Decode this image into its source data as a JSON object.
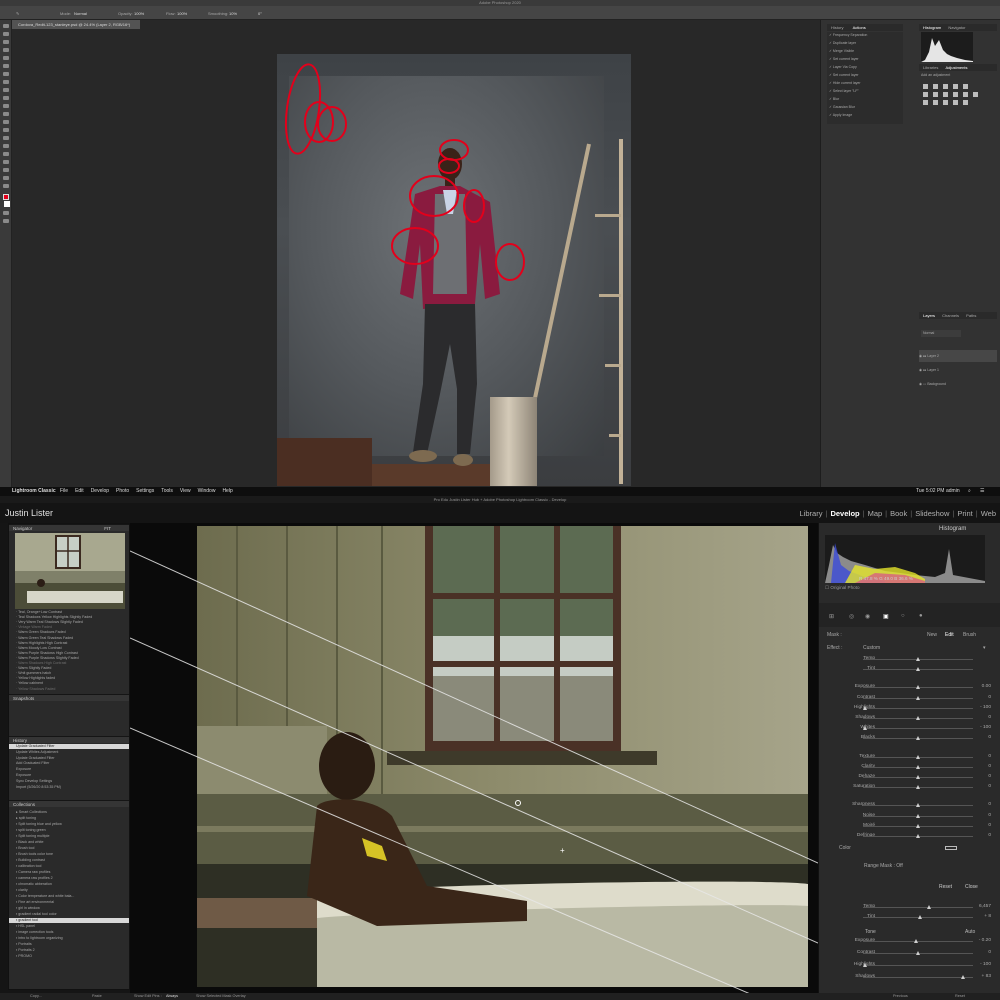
{
  "photoshop": {
    "window_title": "Adobe Photoshop 2020",
    "document_tab": "Cordova_Redit-123_stanleye.psd @ 24.4% (Layer 2, RGB/16*)",
    "options": {
      "mode_label": "Mode:",
      "mode_value": "Normal",
      "opacity_label": "Opacity:",
      "opacity_value": "100%",
      "flow_label": "Flow:",
      "flow_value": "100%",
      "smoothing_label": "Smoothing:",
      "smoothing_value": "10%",
      "angle_value": "0°"
    },
    "panels": {
      "history_tab": "History",
      "actions_tab": "Actions",
      "histogram_tab": "Histogram",
      "navigator_tab": "Navigator",
      "libraries_tab": "Libraries",
      "adjustments_tab": "Adjustments",
      "add_adjustment": "Add an adjustment",
      "layers_tab": "Layers",
      "channels_tab": "Channels",
      "paths_tab": "Paths",
      "blend_mode": "Normal",
      "actions_items": [
        "Frequency Separation",
        "Duplicate layer",
        "Merge Visible",
        "Set current layer",
        "Layer Via Copy",
        "Set current layer",
        "Hide current layer",
        "Select layer \"LF\"",
        "Blur",
        "Gaussian Blur",
        "Apply Image"
      ],
      "layers": [
        {
          "name": "Layer 2"
        },
        {
          "name": "Layer 1"
        },
        {
          "name": "Background"
        }
      ]
    }
  },
  "mac_menubar": {
    "app": "Lightroom Classic",
    "menus": [
      "File",
      "Edit",
      "Develop",
      "Photo",
      "Settings",
      "Tools",
      "View",
      "Window",
      "Help"
    ],
    "clock": "Tue 5:02 PM",
    "user": "admin"
  },
  "lightroom": {
    "window_title": "Pro Edu Justin Lister Hub + Adobe Photoshop Lightroom Classic - Develop",
    "identity_plate": "Justin Lister",
    "modules": [
      {
        "label": "Library",
        "active": false
      },
      {
        "label": "Develop",
        "active": true
      },
      {
        "label": "Map",
        "active": false
      },
      {
        "label": "Book",
        "active": false
      },
      {
        "label": "Slideshow",
        "active": false
      },
      {
        "label": "Print",
        "active": false
      },
      {
        "label": "Web",
        "active": false
      }
    ],
    "left_panel": {
      "navigator_label": "Navigator",
      "navigator_zoom": "FIT",
      "presets": [
        "Teal, Orange+Low Contrast",
        "Teal Shadows Yellow Highlights Slightly Faded",
        "Very Warm Teal Shadows Slightly Faded",
        "Vintage Warm Faded",
        "Warm Green Shadows Faded",
        "Warm Green Teal Shadows Faded",
        "Warm Highlights High Contrast",
        "Warm Moody Low Contrast",
        "Warm Purple Shadows High Contrast",
        "Warm Purple Shadows Slightly Faded",
        "Warm Shadows High Contrast",
        "Warm Slightly Faded",
        "Wnlt gummers hatch",
        "Yellow Highlights faded",
        "Yellow cabinent",
        "Yellow Shadows Faded"
      ],
      "snapshots_label": "Snapshots",
      "history_label": "History",
      "history_items": [
        "Update Graduated Filter",
        "Update Whites Adjustment",
        "Update Graduated Filter",
        "Add Graduated Filter",
        "Exposure",
        "Exposure",
        "Sync Develop Settings",
        "Import (5/26/20 8:53:35 PM)"
      ],
      "collections_label": "Collections",
      "collections": [
        "Smart Collections",
        "split toning",
        "Split toning blue and yellow",
        "split toning green",
        "Split toning multiple",
        "Black and white",
        "Brush tool",
        "Brush tools color tone",
        "Building contrast",
        "calibration tool",
        "Camera raw profiles",
        "camera raw profiles 2",
        "chromatic abberation",
        "clarity",
        "Color temperature and white bala...",
        "Fine art environmental",
        "girl in window",
        "gradient radial tool color",
        "gradient tool",
        "HSL panel",
        "image correction tools",
        "intro to lightroom organizing",
        "Portraits",
        "Portraits 2",
        "PROMO"
      ],
      "copy_button": "Copy...",
      "paste_button": "Paste"
    },
    "right_panel": {
      "histogram_label": "Histogram",
      "histogram_readout": "R 47.8 % G 49.0 B 36.6 %",
      "original_photo_label": "Original Photo",
      "mask_label": "Mask :",
      "mask_new": "New",
      "mask_edit": "Edit",
      "mask_brush": "Brush",
      "effect_label": "Effect :",
      "effect_value": "Custom",
      "mask_sliders": [
        {
          "label": "Temp",
          "value": "",
          "pos": 0.5
        },
        {
          "label": "Tint",
          "value": "",
          "pos": 0.5
        },
        {
          "label": "Exposure",
          "value": "0.00",
          "pos": 0.5
        },
        {
          "label": "Contrast",
          "value": "0",
          "pos": 0.5
        },
        {
          "label": "Highlights",
          "value": "- 100",
          "pos": 0.02
        },
        {
          "label": "Shadows",
          "value": "0",
          "pos": 0.5
        },
        {
          "label": "Whites",
          "value": "- 100",
          "pos": 0.02
        },
        {
          "label": "Blacks",
          "value": "0",
          "pos": 0.5
        },
        {
          "label": "Texture",
          "value": "0",
          "pos": 0.5
        },
        {
          "label": "Clarity",
          "value": "0",
          "pos": 0.5
        },
        {
          "label": "Dehaze",
          "value": "0",
          "pos": 0.5
        },
        {
          "label": "Saturation",
          "value": "0",
          "pos": 0.5
        },
        {
          "label": "Sharpness",
          "value": "0",
          "pos": 0.5
        },
        {
          "label": "Noise",
          "value": "0",
          "pos": 0.5
        },
        {
          "label": "Moiré",
          "value": "0",
          "pos": 0.5
        },
        {
          "label": "Defringe",
          "value": "0",
          "pos": 0.5
        }
      ],
      "color_label": "Color",
      "range_mask_label": "Range Mask : Off",
      "reset_button": "Reset",
      "close_button": "Close",
      "basic_sliders": [
        {
          "label": "Temp",
          "value": "6,457",
          "pos": 0.6
        },
        {
          "label": "Tint",
          "value": "+ 8",
          "pos": 0.52
        }
      ],
      "tone_label": "Tone",
      "tone_auto": "Auto",
      "tone_sliders": [
        {
          "label": "Exposure",
          "value": "- 0.20",
          "pos": 0.48
        },
        {
          "label": "Contrast",
          "value": "0",
          "pos": 0.5
        },
        {
          "label": "Highlights",
          "value": "- 100",
          "pos": 0.02
        },
        {
          "label": "Shadows",
          "value": "+ 83",
          "pos": 0.91
        }
      ],
      "previous_button": "Previous",
      "reset_bottom_button": "Reset"
    },
    "toolbar": {
      "show_edit_pins": "Show Edit Pins :",
      "show_edit_pins_value": "Always",
      "show_overlay": "Show Selected Mask Overlay"
    }
  }
}
